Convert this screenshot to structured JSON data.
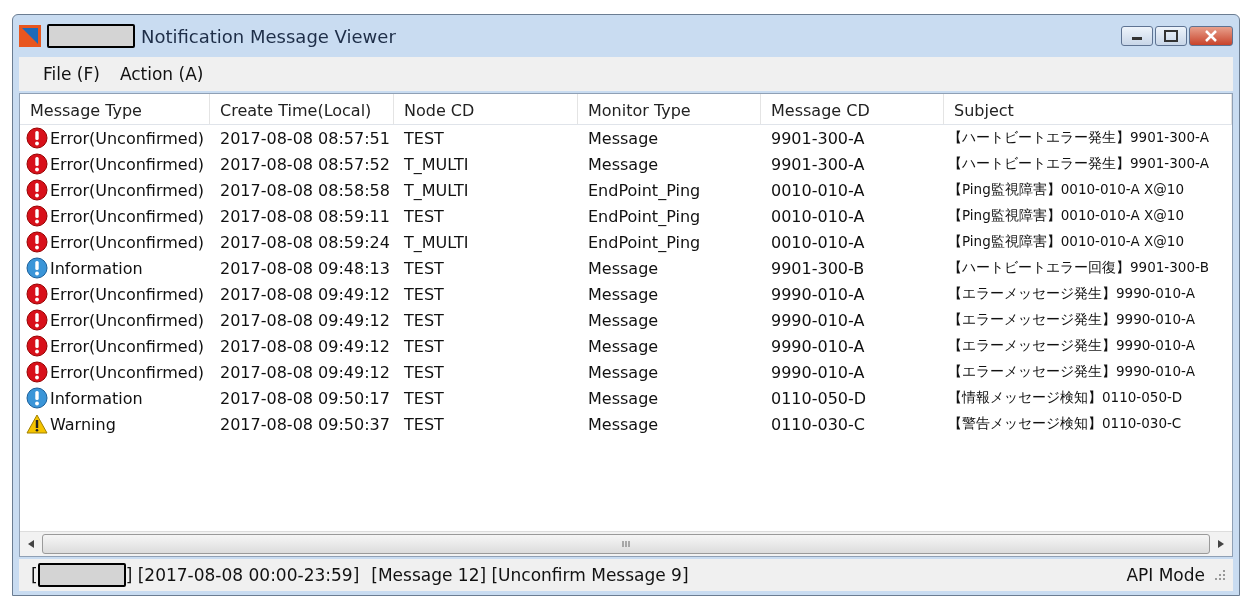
{
  "window": {
    "title": "Notification Message Viewer"
  },
  "menu": [
    "File (F)",
    "Action (A)"
  ],
  "table": {
    "columns": [
      "Message Type",
      "Create Time(Local)",
      "Node CD",
      "Monitor Type",
      "Message CD",
      "Subject"
    ],
    "rows": [
      {
        "kind": "error",
        "cells": [
          "Error(Unconfirmed)",
          "2017-08-08 08:57:51",
          "TEST",
          "Message",
          "9901-300-A",
          "【ハートビートエラー発生】9901-300-A"
        ]
      },
      {
        "kind": "error",
        "cells": [
          "Error(Unconfirmed)",
          "2017-08-08 08:57:52",
          "T_MULTI",
          "Message",
          "9901-300-A",
          "【ハートビートエラー発生】9901-300-A"
        ]
      },
      {
        "kind": "error",
        "cells": [
          "Error(Unconfirmed)",
          "2017-08-08 08:58:58",
          "T_MULTI",
          "EndPoint_Ping",
          "0010-010-A",
          "【Ping監視障害】0010-010-A X@10"
        ]
      },
      {
        "kind": "error",
        "cells": [
          "Error(Unconfirmed)",
          "2017-08-08 08:59:11",
          "TEST",
          "EndPoint_Ping",
          "0010-010-A",
          "【Ping監視障害】0010-010-A X@10"
        ]
      },
      {
        "kind": "error",
        "cells": [
          "Error(Unconfirmed)",
          "2017-08-08 08:59:24",
          "T_MULTI",
          "EndPoint_Ping",
          "0010-010-A",
          "【Ping監視障害】0010-010-A X@10"
        ]
      },
      {
        "kind": "info",
        "cells": [
          "Information",
          "2017-08-08 09:48:13",
          "TEST",
          "Message",
          "9901-300-B",
          "【ハートビートエラー回復】9901-300-B"
        ]
      },
      {
        "kind": "error",
        "cells": [
          "Error(Unconfirmed)",
          "2017-08-08 09:49:12",
          "TEST",
          "Message",
          "9990-010-A",
          "【エラーメッセージ発生】9990-010-A"
        ]
      },
      {
        "kind": "error",
        "cells": [
          "Error(Unconfirmed)",
          "2017-08-08 09:49:12",
          "TEST",
          "Message",
          "9990-010-A",
          "【エラーメッセージ発生】9990-010-A"
        ]
      },
      {
        "kind": "error",
        "cells": [
          "Error(Unconfirmed)",
          "2017-08-08 09:49:12",
          "TEST",
          "Message",
          "9990-010-A",
          "【エラーメッセージ発生】9990-010-A"
        ]
      },
      {
        "kind": "error",
        "cells": [
          "Error(Unconfirmed)",
          "2017-08-08 09:49:12",
          "TEST",
          "Message",
          "9990-010-A",
          "【エラーメッセージ発生】9990-010-A"
        ]
      },
      {
        "kind": "info",
        "cells": [
          "Information",
          "2017-08-08 09:50:17",
          "TEST",
          "Message",
          "0110-050-D",
          "【情報メッセージ検知】0110-050-D"
        ]
      },
      {
        "kind": "warning",
        "cells": [
          "Warning",
          "2017-08-08 09:50:37",
          "TEST",
          "Message",
          "0110-030-C",
          "【警告メッセージ検知】0110-030-C"
        ]
      }
    ]
  },
  "status_bar": {
    "open": "[",
    "range": "] [2017-08-08 00:00-23:59]",
    "counts": "[Message 12] [Unconfirm Message 9]",
    "mode": "API Mode"
  }
}
